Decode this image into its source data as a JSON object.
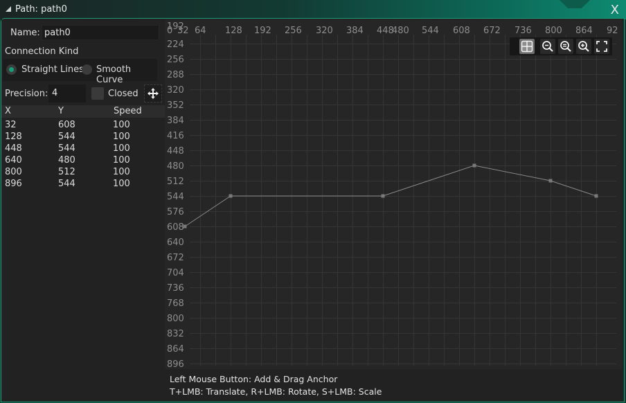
{
  "window": {
    "title": "Path: path0",
    "close_label": "X"
  },
  "properties": {
    "name_label": "Name:",
    "name_value": "path0",
    "connection_kind_label": "Connection Kind",
    "connection_options": [
      {
        "label": "Straight Lines",
        "selected": true
      },
      {
        "label": "Smooth Curve",
        "selected": false
      }
    ],
    "precision_label": "Precision:",
    "precision_value": "4",
    "closed_label": "Closed",
    "closed_checked": false
  },
  "points_table": {
    "columns": [
      "X",
      "Y",
      "Speed"
    ],
    "rows": [
      {
        "x": "32",
        "y": "608",
        "speed": "100"
      },
      {
        "x": "128",
        "y": "544",
        "speed": "100"
      },
      {
        "x": "448",
        "y": "544",
        "speed": "100"
      },
      {
        "x": "640",
        "y": "480",
        "speed": "100"
      },
      {
        "x": "800",
        "y": "512",
        "speed": "100"
      },
      {
        "x": "896",
        "y": "544",
        "speed": "100"
      }
    ]
  },
  "canvas": {
    "x_ticks": [
      "0",
      "32",
      "64",
      "128",
      "192",
      "256",
      "320",
      "384",
      "448",
      "480",
      "544",
      "608",
      "672",
      "736",
      "800",
      "864",
      "92"
    ],
    "y_ticks": [
      "192",
      "224",
      "256",
      "288",
      "320",
      "352",
      "384",
      "416",
      "448",
      "480",
      "512",
      "544",
      "576",
      "608",
      "640",
      "672",
      "704",
      "736",
      "768",
      "800",
      "832",
      "864",
      "896"
    ],
    "path_points": [
      [
        32,
        608
      ],
      [
        128,
        544
      ],
      [
        448,
        544
      ],
      [
        640,
        480
      ],
      [
        800,
        512
      ],
      [
        896,
        544
      ]
    ],
    "toolbar": [
      {
        "icon": "grid-toggle-icon",
        "active": true
      },
      {
        "icon": "zoom-out-icon",
        "active": false
      },
      {
        "icon": "zoom-reset-icon",
        "active": false
      },
      {
        "icon": "zoom-in-icon",
        "active": false
      },
      {
        "icon": "fullscreen-icon",
        "active": false
      }
    ]
  },
  "status": {
    "line1": "Left Mouse Button: Add & Drag Anchor",
    "line2": "T+LMB: Translate, R+LMB: Rotate, S+LMB: Scale"
  },
  "colors": {
    "accent": "#13a07b",
    "frame_border": "#1f9a78",
    "grid_line": "#353535",
    "path_line": "#8a8a8a"
  }
}
